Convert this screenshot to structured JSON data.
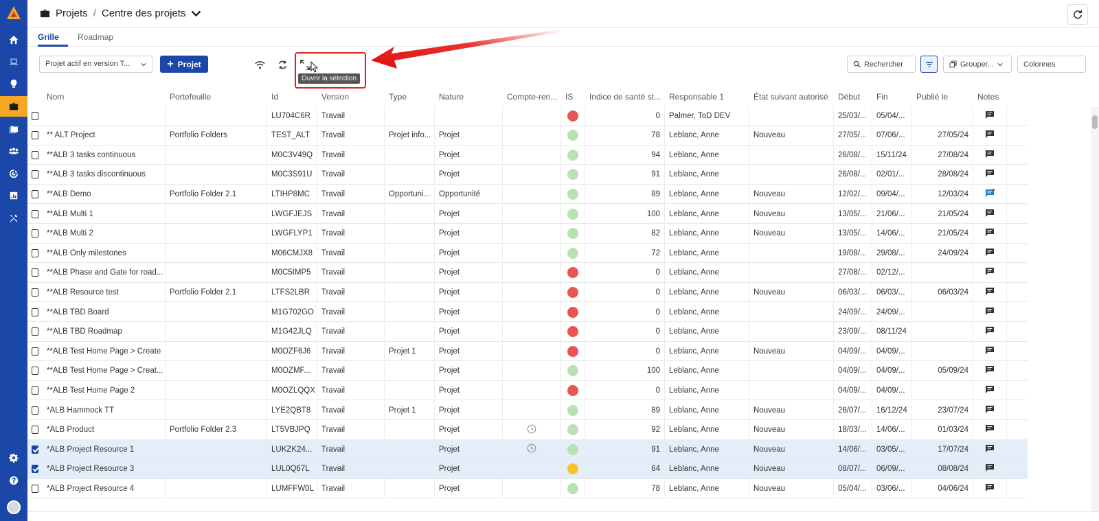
{
  "header": {
    "section": "Projets",
    "separator": "/",
    "page_title": "Centre des projets"
  },
  "tabs": [
    {
      "label": "Grille",
      "active": true
    },
    {
      "label": "Roadmap",
      "active": false
    }
  ],
  "toolbar": {
    "filter_value": "Projet actif en version T...",
    "add_label": "Projet",
    "tooltip": "Ouvrir la sélection",
    "search_label": "Rechercher",
    "group_label": "Grouper...",
    "columns_label": "Colonnes"
  },
  "colors": {
    "brand": "#1a47a8",
    "active_nav": "#f5a623",
    "red": "#ea5455",
    "green": "#b7e3b0",
    "yellow": "#f7c325"
  },
  "sidebar": {
    "items": [
      "home-icon",
      "laptop-icon",
      "lightbulb-icon",
      "briefcase-icon",
      "folders-icon",
      "team-icon",
      "target-icon",
      "report-icon",
      "tools-icon"
    ],
    "bottom": [
      "settings-icon",
      "help-icon",
      "avatar"
    ],
    "active": "briefcase-icon"
  },
  "columns": [
    "Nom",
    "Portefeuille",
    "Id",
    "Version",
    "Type",
    "Nature",
    "Compte-ren...",
    "IS",
    "Indice de santé st...",
    "Responsable 1",
    "État suivant autorisé",
    "Début",
    "Fin",
    "Publié le",
    "Notes"
  ],
  "rows": [
    {
      "checked": false,
      "name": "",
      "portfolio": "",
      "id": "LU704C6R",
      "version": "Travail",
      "type": "",
      "nature": "",
      "report": "",
      "is": "red",
      "health": "0",
      "owner": "Palmer, ToD DEV",
      "next_state": "",
      "start": "25/03/...",
      "end": "05/04/...",
      "published": "",
      "note_new": false
    },
    {
      "checked": false,
      "name": "** ALT Project",
      "portfolio": "Portfolio Folders",
      "id": "TEST_ALT",
      "version": "Travail",
      "type": "Projet info...",
      "nature": "Projet",
      "report": "",
      "is": "green",
      "health": "78",
      "owner": "Leblanc, Anne",
      "next_state": "Nouveau",
      "start": "27/05/...",
      "end": "07/06/...",
      "published": "27/05/24",
      "note_new": false
    },
    {
      "checked": false,
      "name": "**ALB 3 tasks continuous",
      "portfolio": "",
      "id": "M0C3V49Q",
      "version": "Travail",
      "type": "",
      "nature": "Projet",
      "report": "",
      "is": "green",
      "health": "94",
      "owner": "Leblanc, Anne",
      "next_state": "",
      "start": "26/08/...",
      "end": "15/11/24",
      "published": "27/08/24",
      "note_new": false
    },
    {
      "checked": false,
      "name": "**ALB 3 tasks discontinuous",
      "portfolio": "",
      "id": "M0C3S91U",
      "version": "Travail",
      "type": "",
      "nature": "Projet",
      "report": "",
      "is": "green",
      "health": "91",
      "owner": "Leblanc, Anne",
      "next_state": "",
      "start": "26/08/...",
      "end": "02/01/...",
      "published": "28/08/24",
      "note_new": false
    },
    {
      "checked": false,
      "name": "**ALB Demo",
      "portfolio": "Portfolio Folder 2.1",
      "id": "LTIHP8MC",
      "version": "Travail",
      "type": "Opportuni...",
      "nature": "Opportunité",
      "report": "",
      "is": "green",
      "health": "89",
      "owner": "Leblanc, Anne",
      "next_state": "Nouveau",
      "start": "12/02/...",
      "end": "09/04/...",
      "published": "12/03/24",
      "note_new": true
    },
    {
      "checked": false,
      "name": "**ALB Multi 1",
      "portfolio": "",
      "id": "LWGFJEJS",
      "version": "Travail",
      "type": "",
      "nature": "Projet",
      "report": "",
      "is": "green",
      "health": "100",
      "owner": "Leblanc, Anne",
      "next_state": "Nouveau",
      "start": "13/05/...",
      "end": "21/06/...",
      "published": "21/05/24",
      "note_new": false
    },
    {
      "checked": false,
      "name": "**ALB Multi 2",
      "portfolio": "",
      "id": "LWGFLYP1",
      "version": "Travail",
      "type": "",
      "nature": "Projet",
      "report": "",
      "is": "green",
      "health": "82",
      "owner": "Leblanc, Anne",
      "next_state": "Nouveau",
      "start": "13/05/...",
      "end": "14/06/...",
      "published": "21/05/24",
      "note_new": false
    },
    {
      "checked": false,
      "name": "**ALB Only milestones",
      "portfolio": "",
      "id": "M06CMJX8",
      "version": "Travail",
      "type": "",
      "nature": "Projet",
      "report": "",
      "is": "green",
      "health": "72",
      "owner": "Leblanc, Anne",
      "next_state": "",
      "start": "19/08/...",
      "end": "29/08/...",
      "published": "24/09/24",
      "note_new": false
    },
    {
      "checked": false,
      "name": "**ALB Phase and Gate for road...",
      "portfolio": "",
      "id": "M0C5IMP5",
      "version": "Travail",
      "type": "",
      "nature": "Projet",
      "report": "",
      "is": "red",
      "health": "0",
      "owner": "Leblanc, Anne",
      "next_state": "",
      "start": "27/08/...",
      "end": "02/12/...",
      "published": "",
      "note_new": false
    },
    {
      "checked": false,
      "name": "**ALB Resource test",
      "portfolio": "Portfolio Folder 2.1",
      "id": "LTFS2LBR",
      "version": "Travail",
      "type": "",
      "nature": "Projet",
      "report": "",
      "is": "red",
      "health": "0",
      "owner": "Leblanc, Anne",
      "next_state": "Nouveau",
      "start": "06/03/...",
      "end": "06/03/...",
      "published": "06/03/24",
      "note_new": false
    },
    {
      "checked": false,
      "name": "**ALB TBD Board",
      "portfolio": "",
      "id": "M1G702GO",
      "version": "Travail",
      "type": "",
      "nature": "Projet",
      "report": "",
      "is": "red",
      "health": "0",
      "owner": "Leblanc, Anne",
      "next_state": "",
      "start": "24/09/...",
      "end": "24/09/...",
      "published": "",
      "note_new": false
    },
    {
      "checked": false,
      "name": "**ALB TBD Roadmap",
      "portfolio": "",
      "id": "M1G42JLQ",
      "version": "Travail",
      "type": "",
      "nature": "Projet",
      "report": "",
      "is": "red",
      "health": "0",
      "owner": "Leblanc, Anne",
      "next_state": "",
      "start": "23/09/...",
      "end": "08/11/24",
      "published": "",
      "note_new": false
    },
    {
      "checked": false,
      "name": "**ALB Test Home Page > Create",
      "portfolio": "",
      "id": "M0OZF6J6",
      "version": "Travail",
      "type": "Projet 1",
      "nature": "Projet",
      "report": "",
      "is": "red",
      "health": "0",
      "owner": "Leblanc, Anne",
      "next_state": "Nouveau",
      "start": "04/09/...",
      "end": "04/09/...",
      "published": "",
      "note_new": false
    },
    {
      "checked": false,
      "name": "**ALB Test Home Page > Creat...",
      "portfolio": "",
      "id": "M0OZMF...",
      "version": "Travail",
      "type": "",
      "nature": "Projet",
      "report": "",
      "is": "green",
      "health": "100",
      "owner": "Leblanc, Anne",
      "next_state": "",
      "start": "04/09/...",
      "end": "04/09/...",
      "published": "05/09/24",
      "note_new": false
    },
    {
      "checked": false,
      "name": "**ALB Test Home Page 2",
      "portfolio": "",
      "id": "M0OZLQQX",
      "version": "Travail",
      "type": "",
      "nature": "Projet",
      "report": "",
      "is": "red",
      "health": "0",
      "owner": "Leblanc, Anne",
      "next_state": "",
      "start": "04/09/...",
      "end": "04/09/...",
      "published": "",
      "note_new": false
    },
    {
      "checked": false,
      "name": "*ALB Hammock TT",
      "portfolio": "",
      "id": "LYE2QBT8",
      "version": "Travail",
      "type": "Projet 1",
      "nature": "Projet",
      "report": "",
      "is": "green",
      "health": "89",
      "owner": "Leblanc, Anne",
      "next_state": "Nouveau",
      "start": "26/07/...",
      "end": "16/12/24",
      "published": "23/07/24",
      "note_new": false
    },
    {
      "checked": false,
      "name": "*ALB Product",
      "portfolio": "Portfolio Folder 2.3",
      "id": "LT5VBJPQ",
      "version": "Travail",
      "type": "",
      "nature": "Projet",
      "report": "clock",
      "is": "green",
      "health": "92",
      "owner": "Leblanc, Anne",
      "next_state": "Nouveau",
      "start": "18/03/...",
      "end": "14/06/...",
      "published": "01/03/24",
      "note_new": false
    },
    {
      "checked": true,
      "name": "*ALB Project Resource 1",
      "portfolio": "",
      "id": "LUKZK24...",
      "version": "Travail",
      "type": "",
      "nature": "Projet",
      "report": "clock",
      "is": "green",
      "health": "91",
      "owner": "Leblanc, Anne",
      "next_state": "Nouveau",
      "start": "14/06/...",
      "end": "03/05/...",
      "published": "17/07/24",
      "note_new": false
    },
    {
      "checked": true,
      "name": "*ALB Project Resource 3",
      "portfolio": "",
      "id": "LUL0Q67L",
      "version": "Travail",
      "type": "",
      "nature": "Projet",
      "report": "",
      "is": "yellow",
      "health": "64",
      "owner": "Leblanc, Anne",
      "next_state": "Nouveau",
      "start": "08/07/...",
      "end": "06/09/...",
      "published": "08/08/24",
      "note_new": false
    },
    {
      "checked": false,
      "name": "*ALB Project Resource 4",
      "portfolio": "",
      "id": "LUMFFW0L",
      "version": "Travail",
      "type": "",
      "nature": "Projet",
      "report": "",
      "is": "green",
      "health": "78",
      "owner": "Leblanc, Anne",
      "next_state": "Nouveau",
      "start": "05/04/...",
      "end": "03/06/...",
      "published": "04/06/24",
      "note_new": false
    }
  ]
}
